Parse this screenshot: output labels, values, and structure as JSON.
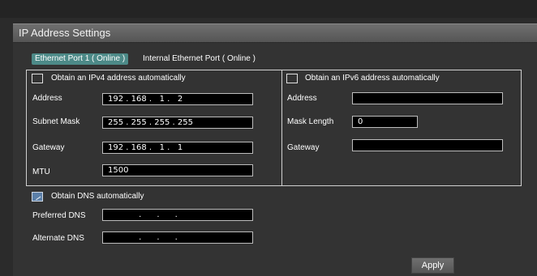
{
  "title": "IP Address Settings",
  "tabs": [
    {
      "label": "Ethernet Port 1 ( Online )",
      "active": true
    },
    {
      "label": "Internal Ethernet Port ( Online )",
      "active": false
    }
  ],
  "ipv4": {
    "auto_label": "Obtain an IPv4 address automatically",
    "auto_checked": false,
    "address_label": "Address",
    "address_value": "192 . 168 .   1 .   2",
    "subnet_label": "Subnet Mask",
    "subnet_value": "255 . 255 . 255 . 255",
    "gateway_label": "Gateway",
    "gateway_value": "192 . 168 .   1 .   1",
    "mtu_label": "MTU",
    "mtu_value": "1500"
  },
  "ipv6": {
    "auto_label": "Obtain an IPv6 address automatically",
    "auto_checked": false,
    "address_label": "Address",
    "address_value": "",
    "mask_label": "Mask Length",
    "mask_value": "0",
    "gateway_label": "Gateway",
    "gateway_value": ""
  },
  "dns": {
    "auto_label": "Obtain DNS automatically",
    "auto_checked": true,
    "preferred_label": "Preferred DNS",
    "preferred_value": "            .      .      .",
    "alternate_label": "Alternate DNS",
    "alternate_value": "            .      .      ."
  },
  "apply_label": "Apply",
  "colors": {
    "tab_active": "#4d8a88",
    "title_bar": "#6f6f6f",
    "background": "#333333"
  }
}
